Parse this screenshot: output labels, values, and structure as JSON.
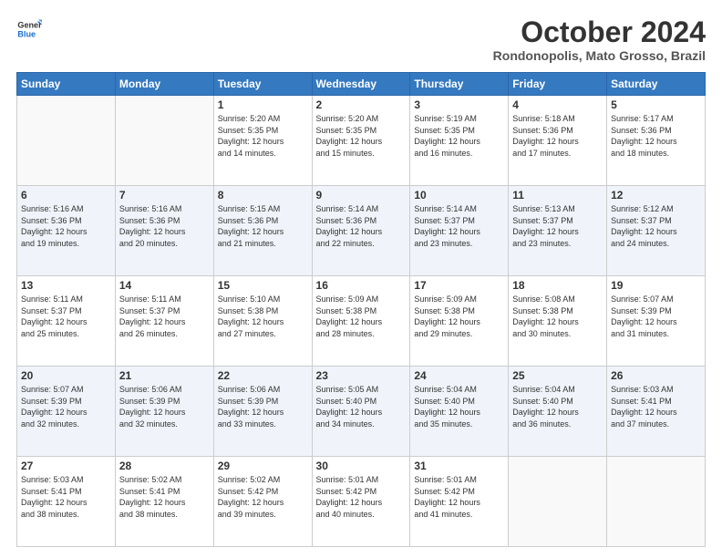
{
  "header": {
    "logo_line1": "General",
    "logo_line2": "Blue",
    "month": "October 2024",
    "location": "Rondonopolis, Mato Grosso, Brazil"
  },
  "weekdays": [
    "Sunday",
    "Monday",
    "Tuesday",
    "Wednesday",
    "Thursday",
    "Friday",
    "Saturday"
  ],
  "weeks": [
    [
      {
        "day": "",
        "info": ""
      },
      {
        "day": "",
        "info": ""
      },
      {
        "day": "1",
        "info": "Sunrise: 5:20 AM\nSunset: 5:35 PM\nDaylight: 12 hours\nand 14 minutes."
      },
      {
        "day": "2",
        "info": "Sunrise: 5:20 AM\nSunset: 5:35 PM\nDaylight: 12 hours\nand 15 minutes."
      },
      {
        "day": "3",
        "info": "Sunrise: 5:19 AM\nSunset: 5:35 PM\nDaylight: 12 hours\nand 16 minutes."
      },
      {
        "day": "4",
        "info": "Sunrise: 5:18 AM\nSunset: 5:36 PM\nDaylight: 12 hours\nand 17 minutes."
      },
      {
        "day": "5",
        "info": "Sunrise: 5:17 AM\nSunset: 5:36 PM\nDaylight: 12 hours\nand 18 minutes."
      }
    ],
    [
      {
        "day": "6",
        "info": "Sunrise: 5:16 AM\nSunset: 5:36 PM\nDaylight: 12 hours\nand 19 minutes."
      },
      {
        "day": "7",
        "info": "Sunrise: 5:16 AM\nSunset: 5:36 PM\nDaylight: 12 hours\nand 20 minutes."
      },
      {
        "day": "8",
        "info": "Sunrise: 5:15 AM\nSunset: 5:36 PM\nDaylight: 12 hours\nand 21 minutes."
      },
      {
        "day": "9",
        "info": "Sunrise: 5:14 AM\nSunset: 5:36 PM\nDaylight: 12 hours\nand 22 minutes."
      },
      {
        "day": "10",
        "info": "Sunrise: 5:14 AM\nSunset: 5:37 PM\nDaylight: 12 hours\nand 23 minutes."
      },
      {
        "day": "11",
        "info": "Sunrise: 5:13 AM\nSunset: 5:37 PM\nDaylight: 12 hours\nand 23 minutes."
      },
      {
        "day": "12",
        "info": "Sunrise: 5:12 AM\nSunset: 5:37 PM\nDaylight: 12 hours\nand 24 minutes."
      }
    ],
    [
      {
        "day": "13",
        "info": "Sunrise: 5:11 AM\nSunset: 5:37 PM\nDaylight: 12 hours\nand 25 minutes."
      },
      {
        "day": "14",
        "info": "Sunrise: 5:11 AM\nSunset: 5:37 PM\nDaylight: 12 hours\nand 26 minutes."
      },
      {
        "day": "15",
        "info": "Sunrise: 5:10 AM\nSunset: 5:38 PM\nDaylight: 12 hours\nand 27 minutes."
      },
      {
        "day": "16",
        "info": "Sunrise: 5:09 AM\nSunset: 5:38 PM\nDaylight: 12 hours\nand 28 minutes."
      },
      {
        "day": "17",
        "info": "Sunrise: 5:09 AM\nSunset: 5:38 PM\nDaylight: 12 hours\nand 29 minutes."
      },
      {
        "day": "18",
        "info": "Sunrise: 5:08 AM\nSunset: 5:38 PM\nDaylight: 12 hours\nand 30 minutes."
      },
      {
        "day": "19",
        "info": "Sunrise: 5:07 AM\nSunset: 5:39 PM\nDaylight: 12 hours\nand 31 minutes."
      }
    ],
    [
      {
        "day": "20",
        "info": "Sunrise: 5:07 AM\nSunset: 5:39 PM\nDaylight: 12 hours\nand 32 minutes."
      },
      {
        "day": "21",
        "info": "Sunrise: 5:06 AM\nSunset: 5:39 PM\nDaylight: 12 hours\nand 32 minutes."
      },
      {
        "day": "22",
        "info": "Sunrise: 5:06 AM\nSunset: 5:39 PM\nDaylight: 12 hours\nand 33 minutes."
      },
      {
        "day": "23",
        "info": "Sunrise: 5:05 AM\nSunset: 5:40 PM\nDaylight: 12 hours\nand 34 minutes."
      },
      {
        "day": "24",
        "info": "Sunrise: 5:04 AM\nSunset: 5:40 PM\nDaylight: 12 hours\nand 35 minutes."
      },
      {
        "day": "25",
        "info": "Sunrise: 5:04 AM\nSunset: 5:40 PM\nDaylight: 12 hours\nand 36 minutes."
      },
      {
        "day": "26",
        "info": "Sunrise: 5:03 AM\nSunset: 5:41 PM\nDaylight: 12 hours\nand 37 minutes."
      }
    ],
    [
      {
        "day": "27",
        "info": "Sunrise: 5:03 AM\nSunset: 5:41 PM\nDaylight: 12 hours\nand 38 minutes."
      },
      {
        "day": "28",
        "info": "Sunrise: 5:02 AM\nSunset: 5:41 PM\nDaylight: 12 hours\nand 38 minutes."
      },
      {
        "day": "29",
        "info": "Sunrise: 5:02 AM\nSunset: 5:42 PM\nDaylight: 12 hours\nand 39 minutes."
      },
      {
        "day": "30",
        "info": "Sunrise: 5:01 AM\nSunset: 5:42 PM\nDaylight: 12 hours\nand 40 minutes."
      },
      {
        "day": "31",
        "info": "Sunrise: 5:01 AM\nSunset: 5:42 PM\nDaylight: 12 hours\nand 41 minutes."
      },
      {
        "day": "",
        "info": ""
      },
      {
        "day": "",
        "info": ""
      }
    ]
  ]
}
